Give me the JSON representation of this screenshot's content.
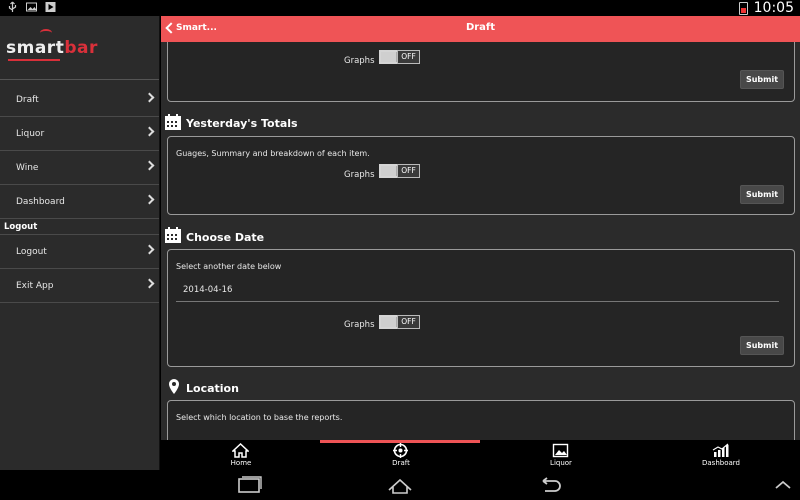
{
  "status_bar": {
    "time": "10:05"
  },
  "sidebar": {
    "logo": {
      "text_a": "smart",
      "text_b": "bar"
    },
    "items": [
      {
        "label": "Draft"
      },
      {
        "label": "Liquor"
      },
      {
        "label": "Wine"
      },
      {
        "label": "Dashboard"
      }
    ],
    "section_logout": "Logout",
    "logout_items": [
      {
        "label": "Logout"
      },
      {
        "label": "Exit App"
      }
    ]
  },
  "header": {
    "back_label": "Smart...",
    "title": "Draft"
  },
  "content": {
    "card_top": {
      "graphs_label": "Graphs",
      "toggle_label": "OFF",
      "submit_label": "Submit"
    },
    "yesterday": {
      "title": "Yesterday's Totals",
      "description": "Guages, Summary and breakdown of each item.",
      "graphs_label": "Graphs",
      "toggle_label": "OFF",
      "submit_label": "Submit"
    },
    "choose_date": {
      "title": "Choose Date",
      "description": "Select another date below",
      "date_value": "2014-04-16",
      "graphs_label": "Graphs",
      "toggle_label": "OFF",
      "submit_label": "Submit"
    },
    "location": {
      "title": "Location",
      "description": "Select which location to base the reports."
    }
  },
  "tabbar": {
    "tabs": [
      {
        "label": "Home",
        "icon": "home-icon"
      },
      {
        "label": "Draft",
        "icon": "target-icon"
      },
      {
        "label": "Liquor",
        "icon": "image-icon"
      },
      {
        "label": "Dashboard",
        "icon": "chart-icon"
      }
    ],
    "active_tab": "Draft"
  },
  "colors": {
    "accent": "#ef5456",
    "background": "#2b2b2b"
  }
}
